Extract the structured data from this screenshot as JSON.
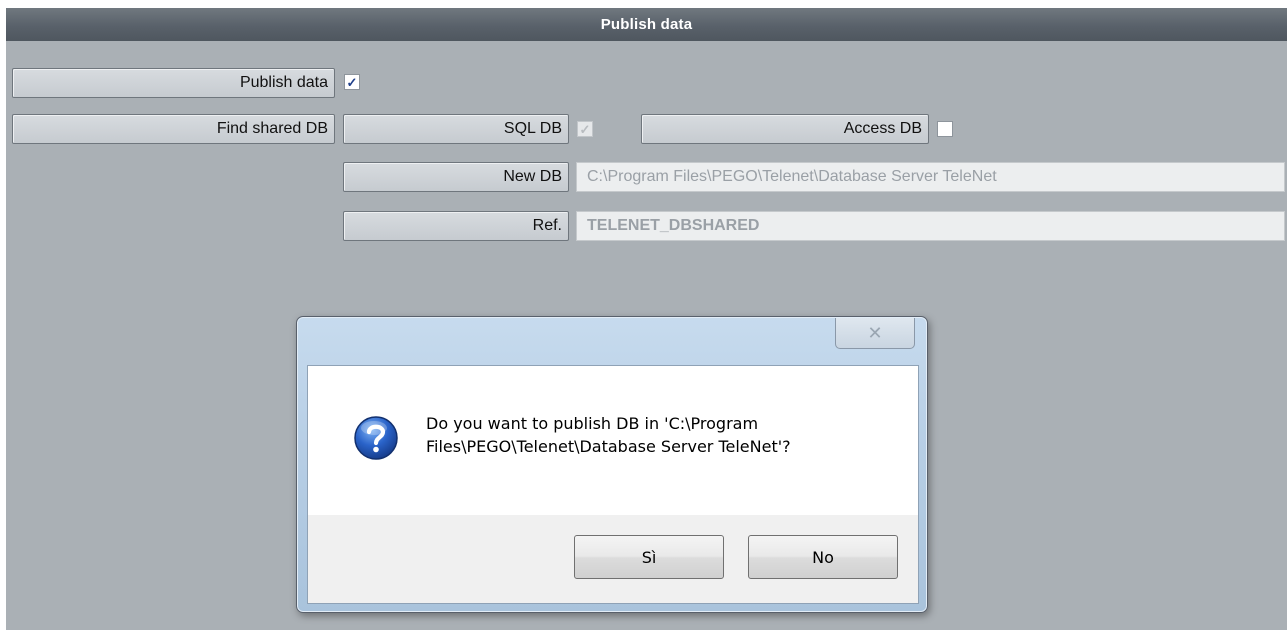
{
  "window": {
    "title": "Publish data"
  },
  "rows": {
    "publish_data": {
      "label": "Publish data",
      "checked": true
    },
    "find_shared_db": {
      "label": "Find shared DB"
    },
    "sql_db": {
      "label": "SQL DB",
      "checked": true,
      "disabled": true
    },
    "access_db": {
      "label": "Access DB",
      "checked": false
    },
    "new_db": {
      "label": "New DB",
      "value": "C:\\Program Files\\PEGO\\Telenet\\Database Server TeleNet"
    },
    "ref": {
      "label": "Ref.",
      "value": "TELENET_DBSHARED"
    }
  },
  "dialog": {
    "close_glyph": "✕",
    "icon": "question-icon",
    "message_line1": "Do you want to publish DB in 'C:\\Program",
    "message_line2": "Files\\PEGO\\Telenet\\Database Server TeleNet'?",
    "yes_label": "Sì",
    "no_label": "No"
  },
  "check_glyph": "✓",
  "colors": {
    "panel": "#aab0b5",
    "title_bar": "#59616a",
    "dialog_frame": "#b8cfe6"
  }
}
